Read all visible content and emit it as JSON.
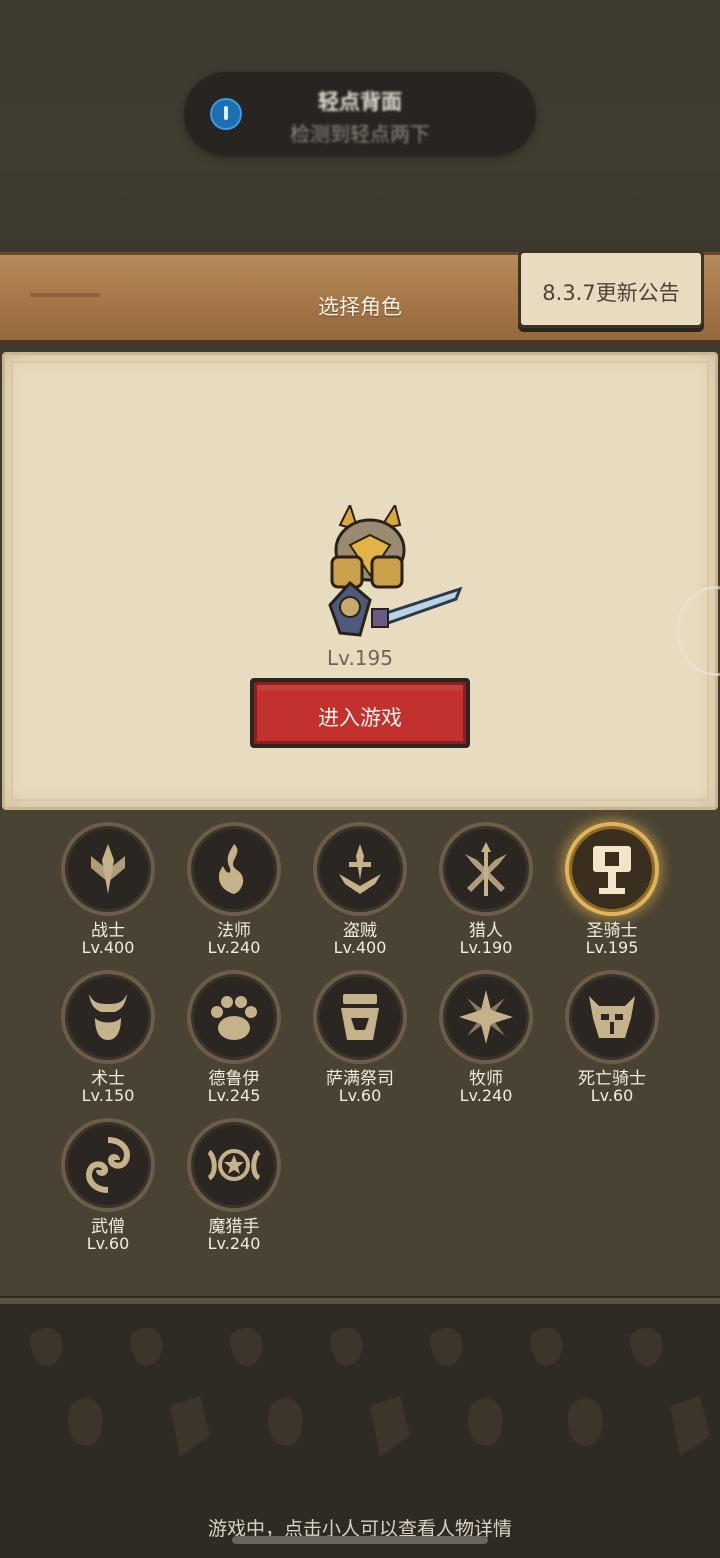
{
  "toast": {
    "title": "轻点背面",
    "subtitle": "检测到轻点两下",
    "icon": "accessibility-icon"
  },
  "header": {
    "title": "选择角色",
    "notice_label": "8.3.7更新公告"
  },
  "character": {
    "level": "Lv.195",
    "enter_label": "进入游戏"
  },
  "classes": [
    {
      "name": "战士",
      "level": "Lv.400",
      "icon": "sword-emblem-icon"
    },
    {
      "name": "法师",
      "level": "Lv.240",
      "icon": "flame-emblem-icon"
    },
    {
      "name": "盗贼",
      "level": "Lv.400",
      "icon": "dagger-emblem-icon"
    },
    {
      "name": "猎人",
      "level": "Lv.190",
      "icon": "crossed-arrows-icon"
    },
    {
      "name": "圣骑士",
      "level": "Lv.195",
      "icon": "hammer-emblem-icon",
      "selected": true
    },
    {
      "name": "术士",
      "level": "Lv.150",
      "icon": "horned-skull-icon"
    },
    {
      "name": "德鲁伊",
      "level": "Lv.245",
      "icon": "paw-icon"
    },
    {
      "name": "萨满祭司",
      "level": "Lv.60",
      "icon": "totem-icon"
    },
    {
      "name": "牧师",
      "level": "Lv.240",
      "icon": "star-burst-icon"
    },
    {
      "name": "死亡骑士",
      "level": "Lv.60",
      "icon": "skull-helm-icon"
    },
    {
      "name": "武僧",
      "level": "Lv.60",
      "icon": "swirl-emblem-icon"
    },
    {
      "name": "魔猎手",
      "level": "Lv.240",
      "icon": "demon-star-icon"
    }
  ],
  "hint": "游戏中，点击小人可以查看人物详情",
  "colors": {
    "background": "#3e3a2f",
    "parchment": "#e8dcc0",
    "enter_button": "#c2312e",
    "selected_glow": "#e0b45a",
    "text_light": "#f3ecdd"
  }
}
